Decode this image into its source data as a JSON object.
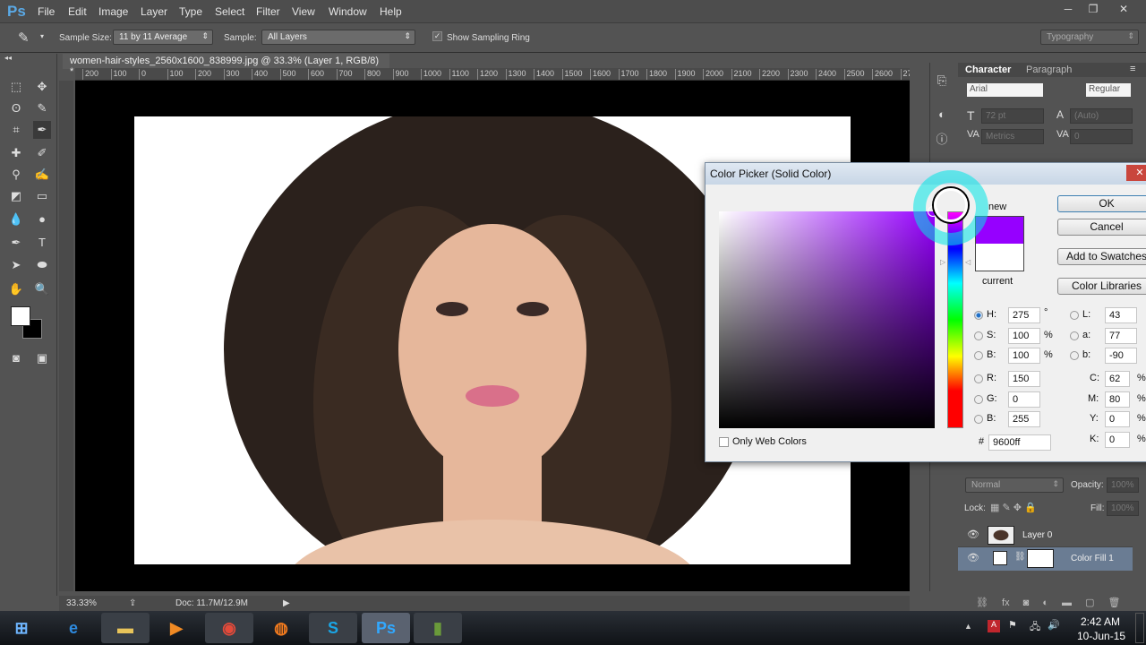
{
  "app": {
    "logo": "Ps",
    "menus": [
      "File",
      "Edit",
      "Image",
      "Layer",
      "Type",
      "Select",
      "Filter",
      "View",
      "Window",
      "Help"
    ],
    "window_buttons": [
      "─",
      "❐",
      "✕"
    ]
  },
  "options": {
    "sample_size_label": "Sample Size:",
    "sample_size_value": "11 by 11 Average",
    "sample_label": "Sample:",
    "sample_value": "All Layers",
    "show_ring_label": "Show Sampling Ring",
    "show_ring_checked": true,
    "workspace": "Typography"
  },
  "document": {
    "tab_title": "women-hair-styles_2560x1600_838999.jpg @ 33.3% (Layer 1, RGB/8) *",
    "close": "×",
    "ruler_labels": [
      "200",
      "100",
      "0",
      "100",
      "200",
      "300",
      "400",
      "500",
      "600",
      "700",
      "800",
      "900",
      "1000",
      "1100",
      "1200",
      "1300",
      "1400",
      "1500",
      "1600",
      "1700",
      "1800",
      "1900",
      "2000",
      "2100",
      "2200",
      "2300",
      "2400",
      "2500",
      "2600",
      "2700"
    ]
  },
  "status": {
    "zoom": "33.33%",
    "doc": "Doc: 11.7M/12.9M"
  },
  "character": {
    "tabs": [
      "Character",
      "Paragraph"
    ],
    "font": "Arial",
    "style": "Regular",
    "size": "72 pt",
    "leading": "(Auto)",
    "kerning": "Metrics",
    "tracking": "0"
  },
  "layers": {
    "blend": "Normal",
    "opacity_label": "Opacity:",
    "opacity": "100%",
    "lock_label": "Lock:",
    "fill_label": "Fill:",
    "fill": "100%",
    "items": [
      {
        "name": "Layer 0",
        "visible": true,
        "selected": false
      },
      {
        "name": "Color Fill 1",
        "visible": true,
        "selected": true
      }
    ]
  },
  "color_picker": {
    "title": "Color Picker (Solid Color)",
    "close": "✕",
    "new_label": "new",
    "current_label": "current",
    "new_color": "#9600ff",
    "current_color": "#ffffff",
    "ok": "OK",
    "cancel": "Cancel",
    "add_swatches": "Add to Swatches",
    "color_libraries": "Color Libraries",
    "only_web_colors": "Only Web Colors",
    "fields": {
      "H": "275",
      "S": "100",
      "B": "100",
      "R": "150",
      "G": "0",
      "Bb": "255",
      "L": "43",
      "a": "77",
      "b": "-90",
      "C": "62",
      "M": "80",
      "Y": "0",
      "K": "0",
      "hex": "9600ff"
    },
    "units": {
      "deg": "°",
      "pct": "%"
    },
    "selected_mode": "H"
  },
  "taskbar": {
    "time": "2:42 AM",
    "date": "10-Jun-15",
    "apps": [
      "start",
      "internet-explorer",
      "file-explorer",
      "media-player",
      "chrome",
      "firefox",
      "skype",
      "photoshop",
      "camtasia"
    ]
  }
}
